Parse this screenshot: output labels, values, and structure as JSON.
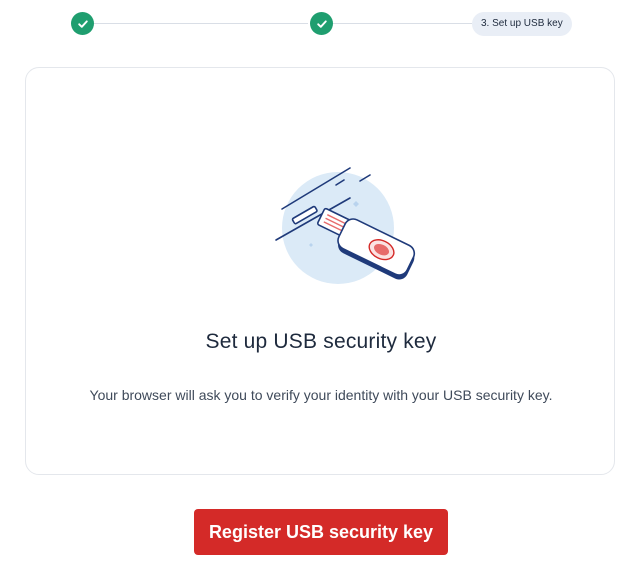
{
  "stepper": {
    "steps": [
      {
        "status": "complete",
        "icon": "check-icon"
      },
      {
        "status": "complete",
        "icon": "check-icon"
      },
      {
        "status": "current",
        "label": "3. Set up USB key"
      }
    ],
    "complete_color": "#1f9e6f"
  },
  "card": {
    "illustration_icon": "usb-security-key-illustration",
    "title": "Set up USB security key",
    "description": "Your browser will ask you to verify your identity with your USB security key."
  },
  "actions": {
    "primary_label": "Register USB security key",
    "primary_color": "#d42a28"
  }
}
